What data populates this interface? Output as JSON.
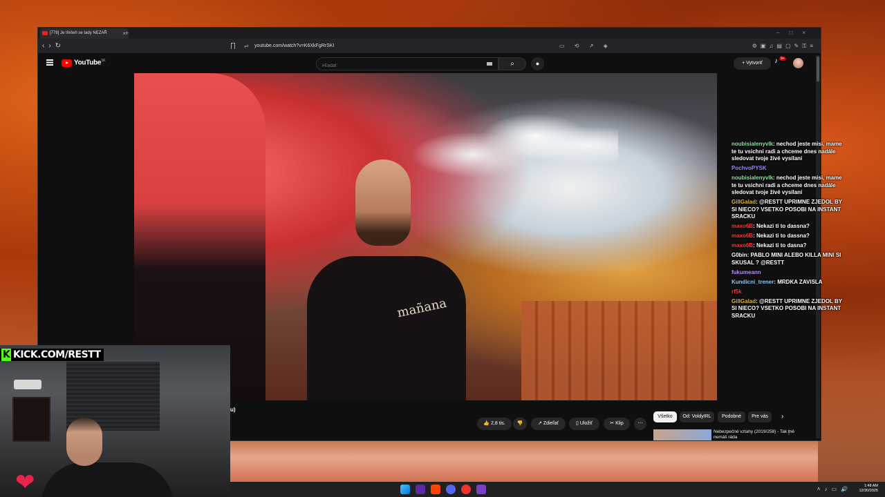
{
  "browser": {
    "tab_title": "[778] Je třešeň se tady NEZAŘ",
    "url": "youtube.com/watch?v=K6XkFgRrSKI"
  },
  "youtube": {
    "logo": "YouTube",
    "region": "SK",
    "search_placeholder": "Hľadať",
    "create_label": "Vytvoriť",
    "notifications": "9+",
    "actions": {
      "likes": "2,8 tis.",
      "share": "Zdieľať",
      "save": "Uložiť",
      "clip": "Klip"
    },
    "video_text": "mañana",
    "title_fragment": "u)",
    "chips": [
      "Všetko",
      "Od: VoldyIRL",
      "Podobné",
      "Pre vás"
    ],
    "recommendation_title": "Nebezpečné vztahy (2019/258) - Tak mě nemáš ráda"
  },
  "chat": [
    {
      "user": "noubisialenyvlk",
      "user_color": "#8de3a0",
      "text": "nechod jeste misi, mame te tu vsichni radi a chceme dnes nadále sledovat tvoje živé vysílaní"
    },
    {
      "user": "PochvoPYSK",
      "user_color": "#9a8cff",
      "text": ""
    },
    {
      "user": "noubisialenyvlk",
      "user_color": "#8de3a0",
      "text": "nechod jeste misi, mame te tu vsichni radi a chceme dnes nadále sledovat tvoje živé vysílaní"
    },
    {
      "user": "GillGalad",
      "user_color": "#e6b83a",
      "text": "@RESTT UPRIMNE ZJEDOL BY SI NIECO? VSETKO POSOBI NA INSTANT SRACKU"
    },
    {
      "user": "maxo6B",
      "user_color": "#ff3b3b",
      "text": "Nekazi ti to dassna?"
    },
    {
      "user": "maxo6B",
      "user_color": "#ff3b3b",
      "text": "Nekazi ti to dassna?"
    },
    {
      "user": "maxo6B",
      "user_color": "#ff3b3b",
      "text": "Nekazi ti to dasna?"
    },
    {
      "user": "G0bin",
      "user_color": "#ffffff",
      "text": "PABLO MINI ALEBO KILLA MINI SI SKUSAL ? @RESTT"
    },
    {
      "user": "fukumeann",
      "user_color": "#c48cff",
      "text": ""
    },
    {
      "user": "Kundicni_trener",
      "user_color": "#8ad0ff",
      "text": "MRDKA ZAVISLA"
    },
    {
      "user": "rf5k",
      "user_color": "#ff3b3b",
      "text": ""
    },
    {
      "user": "GillGalad",
      "user_color": "#e6b83a",
      "text": "@RESTT UPRIMNE ZJEDOL BY SI NIECO? VSETKO POSOBI NA INSTANT SRACKU"
    }
  ],
  "overlay": {
    "kick_badge": "K",
    "kick_url": "KICK.COM/RESTT"
  },
  "taskbar": {
    "time": "1:48 AM",
    "date": "12/30/2025"
  }
}
